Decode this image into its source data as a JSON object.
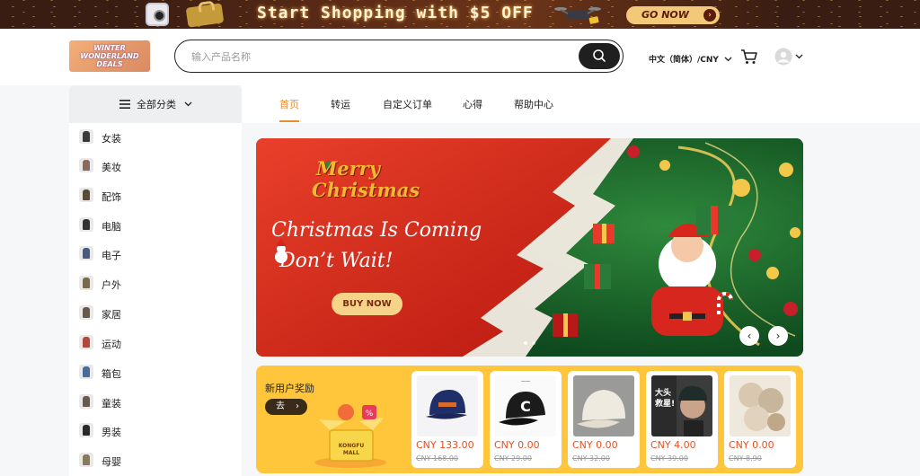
{
  "promo": {
    "headline": "Start Shopping with $5 OFF",
    "cta": "GO NOW",
    "cta_arrow": "›"
  },
  "header": {
    "logo_lines": [
      "WINTER",
      "WONDERLAND",
      "DEALS"
    ],
    "search_placeholder": "输入产品名称",
    "language_currency": "中文（简体）/CNY",
    "icons": [
      "search-icon",
      "cart-icon",
      "avatar-icon",
      "chevron-down-icon"
    ]
  },
  "categories": {
    "all_label": "全部分类",
    "items": [
      {
        "label": "女装",
        "icon": "womens-clothing-icon",
        "color": "#3a3a3a"
      },
      {
        "label": "美妆",
        "icon": "beauty-icon",
        "color": "#8a6a5a"
      },
      {
        "label": "配饰",
        "icon": "accessories-icon",
        "color": "#5a4a3a"
      },
      {
        "label": "电脑",
        "icon": "computer-icon",
        "color": "#333333"
      },
      {
        "label": "电子",
        "icon": "electronics-icon",
        "color": "#4a5a7a"
      },
      {
        "label": "户外",
        "icon": "outdoor-icon",
        "color": "#7a6a4a"
      },
      {
        "label": "家居",
        "icon": "home-icon",
        "color": "#6a5a4a"
      },
      {
        "label": "运动",
        "icon": "sports-icon",
        "color": "#b04a3a"
      },
      {
        "label": "箱包",
        "icon": "bags-icon",
        "color": "#4a6a9a"
      },
      {
        "label": "童装",
        "icon": "kids-clothing-icon",
        "color": "#6a5a4a"
      },
      {
        "label": "男装",
        "icon": "mens-clothing-icon",
        "color": "#2a2a2a"
      },
      {
        "label": "母婴",
        "icon": "mother-baby-icon",
        "color": "#8a7a5a"
      }
    ]
  },
  "nav": {
    "tabs": [
      "首页",
      "转运",
      "自定义订单",
      "心得",
      "帮助中心"
    ],
    "active_index": 0,
    "accent": "#f08a2c"
  },
  "hero": {
    "title_lines": [
      "Merry",
      "Christmas"
    ],
    "line1": "Christmas Is Coming",
    "line2": "Don’t Wait!",
    "cta": "BUY NOW",
    "prev": "‹",
    "next": "›",
    "active_slide": 0,
    "slides": 2
  },
  "newcomer": {
    "title": "新用户奖励",
    "go_label": "去",
    "go_chevron": "›",
    "box_text": [
      "KONGFU",
      "MALL"
    ],
    "products": [
      {
        "price": "CNY 133.00",
        "original": "CNY 168.00",
        "image": "navy-baseball-cap"
      },
      {
        "price": "CNY 0.00",
        "original": "CNY 29.00",
        "image": "black-c-baseball-cap"
      },
      {
        "price": "CNY 0.00",
        "original": "CNY 32.00",
        "image": "cream-fleece-cap"
      },
      {
        "price": "CNY 4.00",
        "original": "CNY 39.00",
        "image": "man-in-cap-photo"
      },
      {
        "price": "CNY 0.00",
        "original": "CNY 8.90",
        "image": "checkered-beret-caps"
      }
    ]
  },
  "colors": {
    "accent": "#f08a2c",
    "price": "#e8501f",
    "strip_bg": "#ffc53b"
  }
}
